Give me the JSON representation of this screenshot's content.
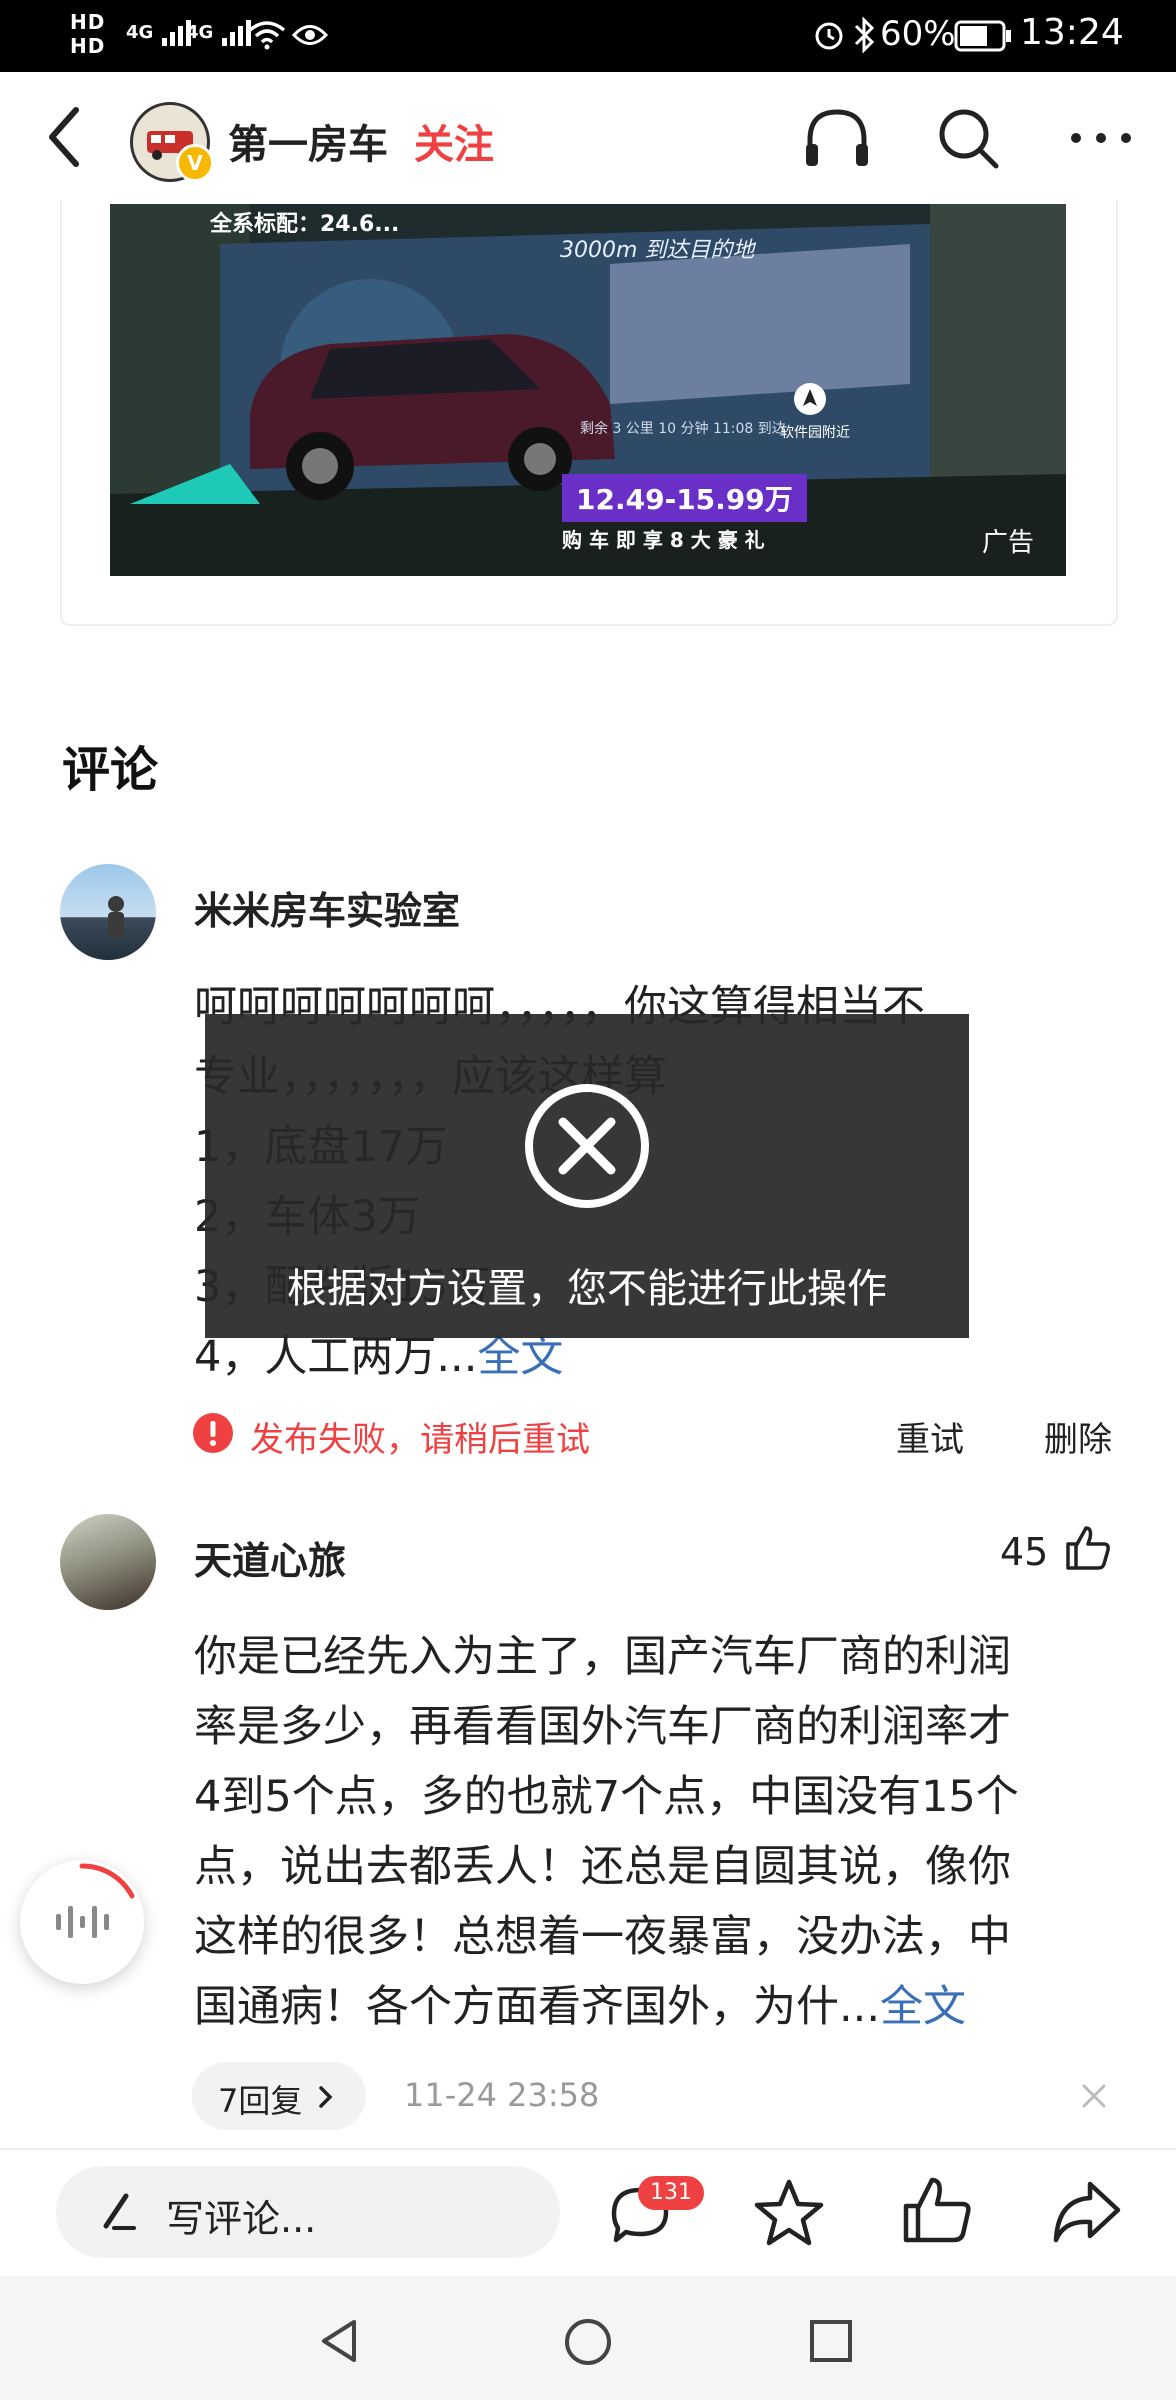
{
  "status_bar": {
    "hd1": "HD",
    "hd2": "HD",
    "net1": "4G",
    "net2": "4G",
    "battery_pct": "60%",
    "time": "13:24"
  },
  "header": {
    "title": "第一房车",
    "follow_label": "关注"
  },
  "ad": {
    "top_text": "全系标配：24.6...",
    "nav_distance": "3000m 到达目的地",
    "nav_info": "剩余 3 公里   10 分钟   11:08 到达",
    "nav_nearby": "软件园附近",
    "price": "12.49-15.99万",
    "slogan": "购 车 即 享 8 大 豪 礼",
    "ad_label": "广告"
  },
  "comments_section": {
    "title": "评论"
  },
  "comments": [
    {
      "name": "米米房车实验室",
      "lines": [
        "呵呵呵呵呵呵呵，，，，，你这算得相当不",
        "专业，，，，，，，应该这样算",
        "1，底盘17万",
        "2，车体3万",
        "3，配件版15万",
        "4，人工两万..."
      ],
      "more": "全文",
      "error": "发布失败，请稍后重试",
      "retry": "重试",
      "delete": "删除"
    },
    {
      "name": "天道心旅",
      "likes": "45",
      "lines": [
        "你是已经先入为主了，国产汽车厂商的利润",
        "率是多少，再看看国外汽车厂商的利润率才",
        "4到5个点，多的也就7个点，中国没有15个",
        "点，说出去都丢人！还总是自圆其说，像你",
        "这样的很多！总想着一夜暴富，没办法，中",
        "国通病！各个方面看齐国外，为什..."
      ],
      "more": "全文",
      "replies": "7回复",
      "time": "11-24 23:58"
    }
  ],
  "toast": {
    "message": "根据对方设置，您不能进行此操作"
  },
  "bottom_bar": {
    "write_placeholder": "写评论...",
    "comment_count": "131"
  },
  "colors": {
    "accent_red": "#f04142",
    "link_blue": "#3a6fb6",
    "price_purple": "#6a2fc6"
  }
}
